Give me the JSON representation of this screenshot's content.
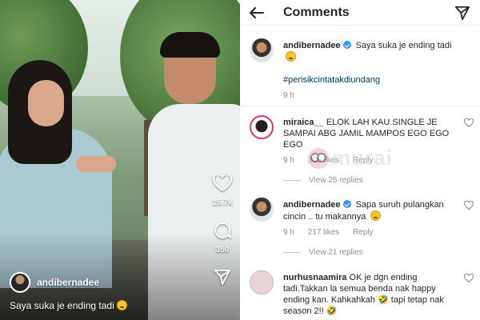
{
  "video": {
    "like_count": "15.7k",
    "comment_count": "350",
    "author": "andibernadee",
    "caption": "Saya suka je ending tadi"
  },
  "header": {
    "title": "Comments"
  },
  "post": {
    "author": "andibernadee",
    "text": "Saya suka je ending tadi",
    "hashtag": "#perisikcintatakdiundang",
    "time": "9 h"
  },
  "comments": [
    {
      "author": "miraica__",
      "text": "ELOK LAH KAU SINGLE JE SAMPAI ABG JAMIL MAMPOS EGO EGO EGO",
      "time": "9 h",
      "likes": "306 likes",
      "reply_label": "Reply",
      "view_replies": "View 25 replies"
    },
    {
      "author": "andibernadee",
      "text": "Sapa suruh pulangkan cincin .. tu makannya",
      "time": "9 h",
      "likes": "217 likes",
      "reply_label": "Reply",
      "view_replies": "View 21 replies"
    },
    {
      "author": "nurhusnaamira",
      "text": "OK je dgn ending tadi.Takkan la semua benda nak happy ending kan. Kahkahkah 🤣 tapi tetap nak season 2!! 🤣"
    }
  ],
  "watermark": "murai",
  "colors": {
    "verified": "#3897f0",
    "hashtag": "#00376b",
    "meta": "#8e8e8e"
  },
  "icons": [
    "heart-icon",
    "comment-icon",
    "send-icon",
    "back-arrow-icon",
    "verified-icon",
    "emoji-icon"
  ]
}
